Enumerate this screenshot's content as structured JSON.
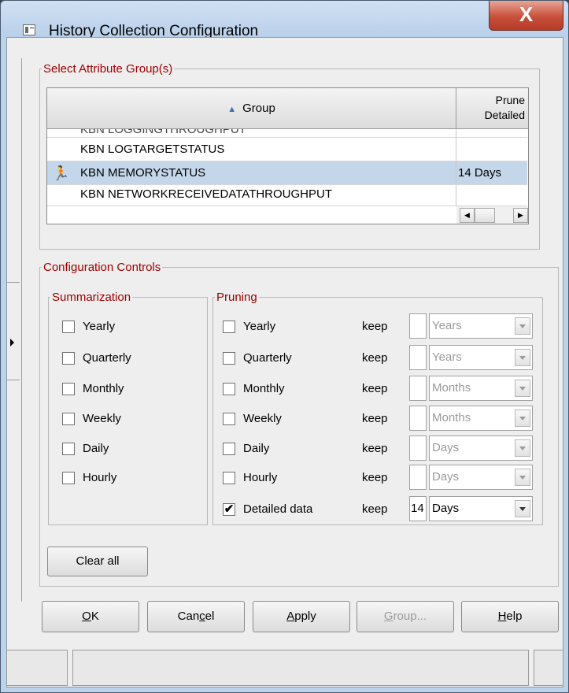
{
  "window": {
    "title": "History Collection Configuration",
    "close_label": "X"
  },
  "attribute_groups": {
    "legend": "Select Attribute Group(s)",
    "columns": {
      "group": "Group",
      "prune_line1": "Prune",
      "prune_line2": "Detailed"
    },
    "rows": [
      {
        "group": "KBN LOGGINGTHROUGHPUT",
        "prune": "",
        "selected": false,
        "partial": true
      },
      {
        "group": "KBN LOGTARGETSTATUS",
        "prune": "",
        "selected": false
      },
      {
        "group": "KBN MEMORYSTATUS",
        "prune": "14 Days",
        "selected": true
      },
      {
        "group": "KBN NETWORKRECEIVEDATATHROUGHPUT",
        "prune": "",
        "selected": false
      }
    ]
  },
  "configuration": {
    "legend": "Configuration Controls",
    "summarization": {
      "legend": "Summarization",
      "items": [
        {
          "label": "Yearly",
          "checked": false
        },
        {
          "label": "Quarterly",
          "checked": false
        },
        {
          "label": "Monthly",
          "checked": false
        },
        {
          "label": "Weekly",
          "checked": false
        },
        {
          "label": "Daily",
          "checked": false
        },
        {
          "label": "Hourly",
          "checked": false
        }
      ]
    },
    "pruning": {
      "legend": "Pruning",
      "keep_label": "keep",
      "items": [
        {
          "label": "Yearly",
          "checked": false,
          "value": "",
          "unit": "Years",
          "enabled": false
        },
        {
          "label": "Quarterly",
          "checked": false,
          "value": "",
          "unit": "Years",
          "enabled": false
        },
        {
          "label": "Monthly",
          "checked": false,
          "value": "",
          "unit": "Months",
          "enabled": false
        },
        {
          "label": "Weekly",
          "checked": false,
          "value": "",
          "unit": "Months",
          "enabled": false
        },
        {
          "label": "Daily",
          "checked": false,
          "value": "",
          "unit": "Days",
          "enabled": false
        },
        {
          "label": "Hourly",
          "checked": false,
          "value": "",
          "unit": "Days",
          "enabled": false
        },
        {
          "label": "Detailed data",
          "checked": true,
          "value": "14",
          "unit": "Days",
          "enabled": true
        }
      ]
    },
    "clear_all_label": "Clear all"
  },
  "buttons": {
    "ok": {
      "first": "O",
      "rest": "K"
    },
    "cancel": {
      "pre": "Can",
      "u": "c",
      "post": "el"
    },
    "apply": {
      "u": "A",
      "rest": "pply"
    },
    "group": {
      "u": "G",
      "rest": "roup..."
    },
    "help": {
      "u": "H",
      "rest": "elp"
    }
  },
  "colors": {
    "legend_text": "#a00000",
    "selected_row": "#c4d7ea",
    "close_button": "#c8503a"
  }
}
